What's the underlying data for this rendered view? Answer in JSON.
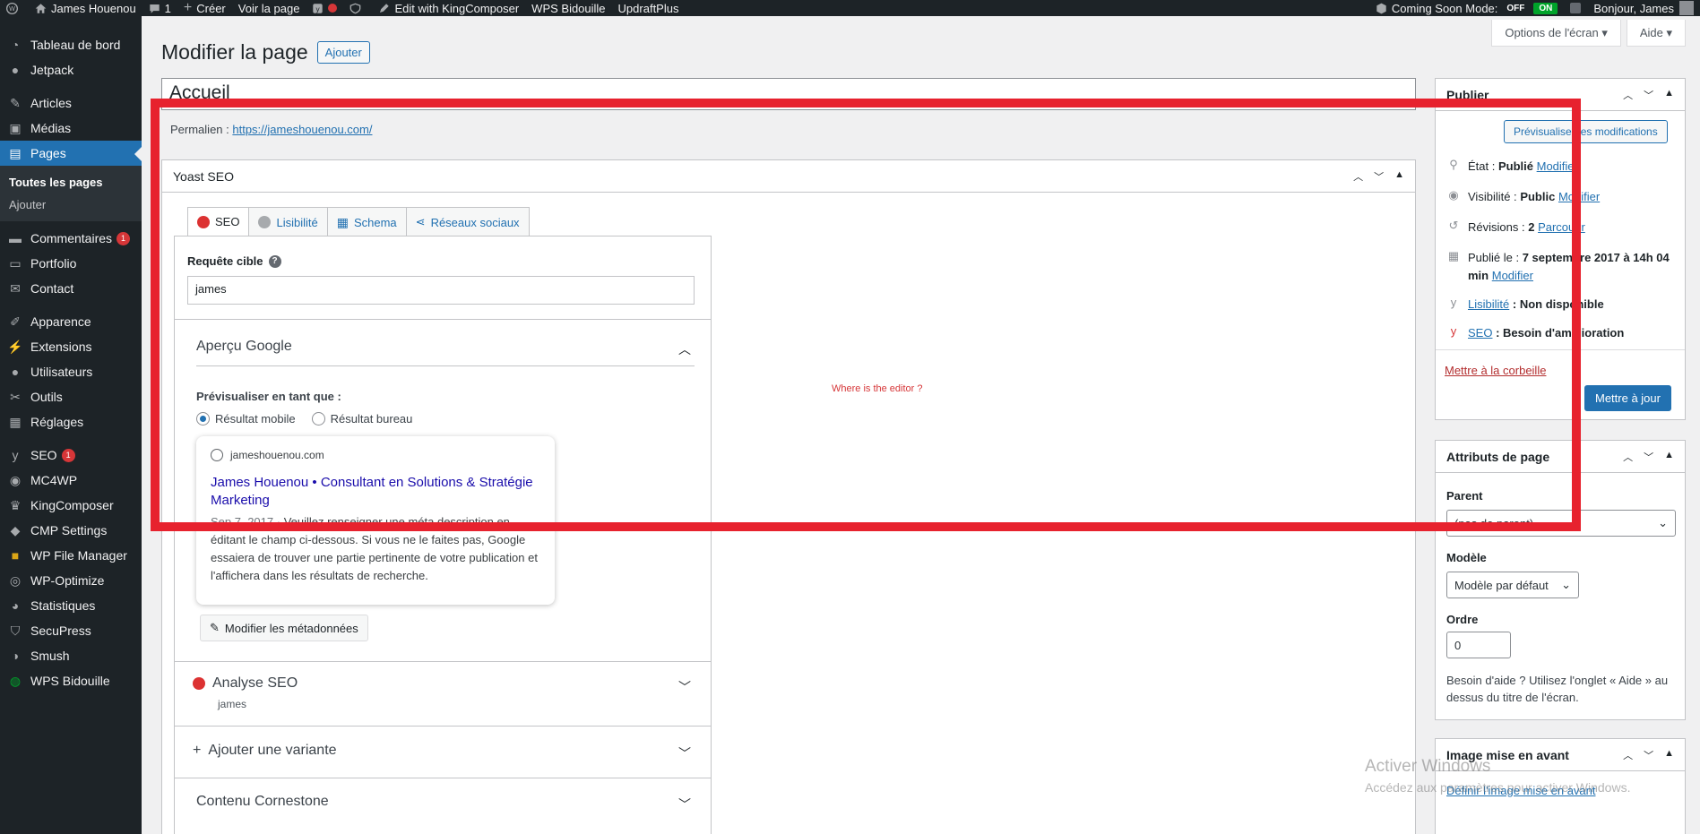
{
  "adminbar": {
    "site_name": "James Houenou",
    "comments_count": "1",
    "new_label": "Créer",
    "view_label": "Voir la page",
    "kingcomposer": "Edit with KingComposer",
    "wps": "WPS Bidouille",
    "updraft": "UpdraftPlus",
    "coming_soon": "Coming Soon Mode:",
    "off": "OFF",
    "on": "ON",
    "greeting": "Bonjour, James"
  },
  "sidebar": {
    "items": [
      {
        "label": "Tableau de bord"
      },
      {
        "label": "Jetpack"
      },
      {
        "label": "Articles"
      },
      {
        "label": "Médias"
      },
      {
        "label": "Pages"
      },
      {
        "label": "Commentaires",
        "badge": "1"
      },
      {
        "label": "Portfolio"
      },
      {
        "label": "Contact"
      },
      {
        "label": "Apparence"
      },
      {
        "label": "Extensions"
      },
      {
        "label": "Utilisateurs"
      },
      {
        "label": "Outils"
      },
      {
        "label": "Réglages"
      },
      {
        "label": "SEO",
        "badge": "1"
      },
      {
        "label": "MC4WP"
      },
      {
        "label": "KingComposer"
      },
      {
        "label": "CMP Settings"
      },
      {
        "label": "WP File Manager"
      },
      {
        "label": "WP-Optimize"
      },
      {
        "label": "Statistiques"
      },
      {
        "label": "SecuPress"
      },
      {
        "label": "Smush"
      },
      {
        "label": "WPS Bidouille"
      }
    ],
    "submenu": [
      "Toutes les pages",
      "Ajouter"
    ]
  },
  "header": {
    "screen_options": "Options de l'écran ▾",
    "help": "Aide ▾",
    "title": "Modifier la page",
    "add_button": "Ajouter"
  },
  "editor": {
    "title_value": "Accueil",
    "permalink_label": "Permalien :",
    "permalink_url": "https://jameshouenou.com/",
    "note": "Where is the editor ?"
  },
  "yoast": {
    "title": "Yoast SEO",
    "tabs": [
      "SEO",
      "Lisibilité",
      "Schema",
      "Réseaux sociaux"
    ],
    "focus_label": "Requête cible",
    "focus_value": "james",
    "google_preview_title": "Aperçu Google",
    "preview_as": "Prévisualiser en tant que :",
    "mobile": "Résultat mobile",
    "desktop": "Résultat bureau",
    "g_url": "jameshouenou.com",
    "g_title": "James Houenou • Consultant en Solutions & Stratégie Marketing",
    "g_date": "Sep 7, 2017 ·",
    "g_desc": "Veuillez renseigner une méta description en éditant le champ ci-dessous. Si vous ne le faites pas, Google essaiera de trouver une partie pertinente de votre publication et l'affichera dans les résultats de recherche.",
    "edit_meta": "Modifier les métadonnées",
    "seo_analysis": "Analyse SEO",
    "seo_analysis_sub": "james",
    "add_variant": "Ajouter une variante",
    "cornerstone": "Contenu Cornestone"
  },
  "publish": {
    "title": "Publier",
    "preview_btn": "Prévisualiser les modifications",
    "status_label": "État :",
    "status_value": "Publié",
    "visibility_label": "Visibilité :",
    "visibility_value": "Public",
    "revisions_label": "Révisions :",
    "revisions_value": "2",
    "browse": "Parcourir",
    "published_label": "Publié le :",
    "published_value": "7 septembre 2017 à 14h 04 min",
    "modify": "Modifier",
    "readability_link": "Lisibilité",
    "readability_value": ": Non disponible",
    "seo_link": "SEO",
    "seo_value": ": Besoin d'amélioration",
    "trash": "Mettre à la corbeille",
    "update": "Mettre à jour"
  },
  "attributes": {
    "title": "Attributs de page",
    "parent_label": "Parent",
    "parent_value": "(pas de parent)",
    "template_label": "Modèle",
    "template_value": "Modèle par défaut",
    "order_label": "Ordre",
    "order_value": "0",
    "help": "Besoin d'aide ? Utilisez l'onglet « Aide » au dessus du titre de l'écran."
  },
  "featured": {
    "title": "Image mise en avant",
    "link": "Définir l'image mise en avant"
  },
  "watermark": {
    "line1": "Activer Windows",
    "line2": "Accédez aux paramètres pour activer Windows."
  },
  "colors": {
    "annotation_frame": "#e7222e",
    "primary": "#2271b1",
    "sidebar_bg": "#1d2327"
  }
}
